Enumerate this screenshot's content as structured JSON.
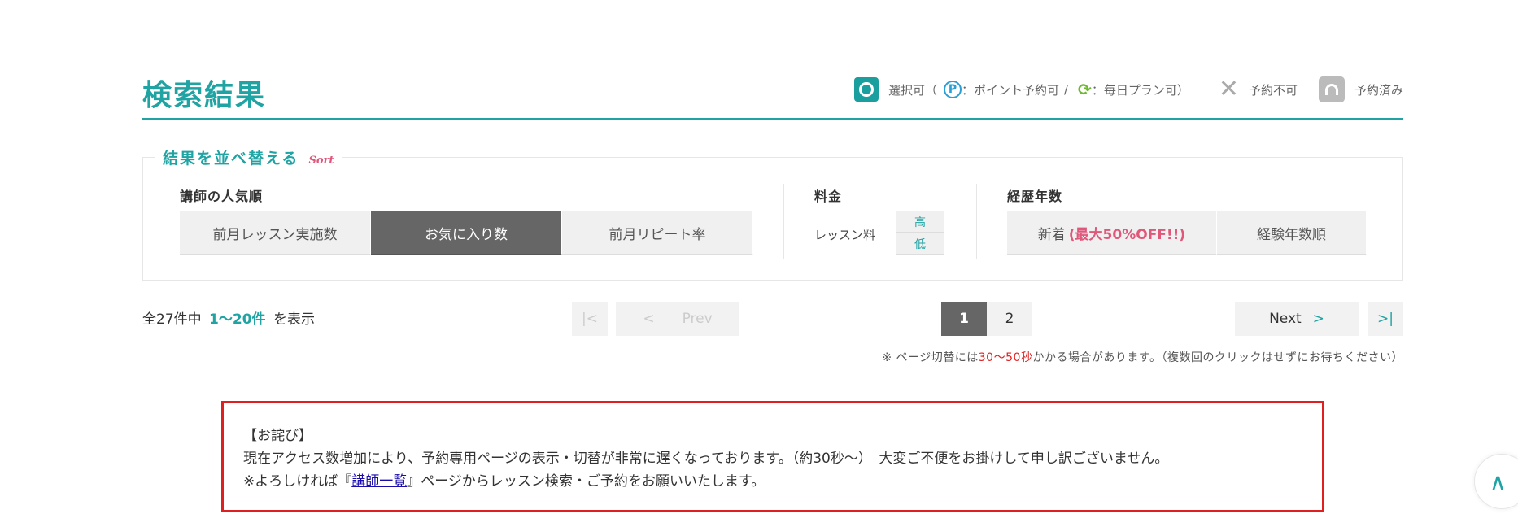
{
  "header": {
    "title": "検索結果",
    "legend": {
      "selectable": "選択可（",
      "point_icon": "P",
      "point": "：ポイント予約可",
      "separator": "/",
      "daily_icon": "⟳",
      "daily": "：毎日プラン可）",
      "unavailable_icon": "✕",
      "unavailable": "予約不可",
      "booked": "予約済み"
    }
  },
  "sort": {
    "title": "結果を並べ替える",
    "title_en": "Sort",
    "popularity": {
      "label": "講師の人気順",
      "options": [
        "前月レッスン実施数",
        "お気に入り数",
        "前月リピート率"
      ],
      "active_index": 1
    },
    "fee": {
      "label": "料金",
      "sub_label": "レッスン料",
      "high": "高",
      "low": "低"
    },
    "experience": {
      "label": "経歴年数",
      "new": "新着",
      "new_badge": "(最大50%OFF!!)",
      "years": "経験年数順"
    }
  },
  "results": {
    "prefix": "全27件中",
    "range": "1～20件",
    "suffix": "を表示"
  },
  "pager": {
    "first": "|<",
    "prev_chev": "<",
    "prev": "Prev",
    "pages": [
      "1",
      "2"
    ],
    "current": "1",
    "next": "Next",
    "next_chev": ">",
    "last": ">|"
  },
  "notice": {
    "part1": "※ ページ切替には",
    "highlight": "30～50秒",
    "part2": "かかる場合があります。（複数回のクリックはせずにお待ちください）"
  },
  "apology": {
    "title": "【お詫び】",
    "line1": "現在アクセス数増加により、予約専用ページの表示・切替が非常に遅くなっております。（約30秒～）　大変ご不便をお掛けして申し訳ございません。",
    "line2_prefix": "※よろしければ『",
    "link": "講師一覧",
    "line2_suffix": "』ページからレッスン検索・ご予約をお願いいたします。"
  },
  "to_top": "∧",
  "colors": {
    "accent": "#1fa3a3",
    "active": "#666666",
    "alert": "#e02020",
    "pink": "#e0577a"
  }
}
